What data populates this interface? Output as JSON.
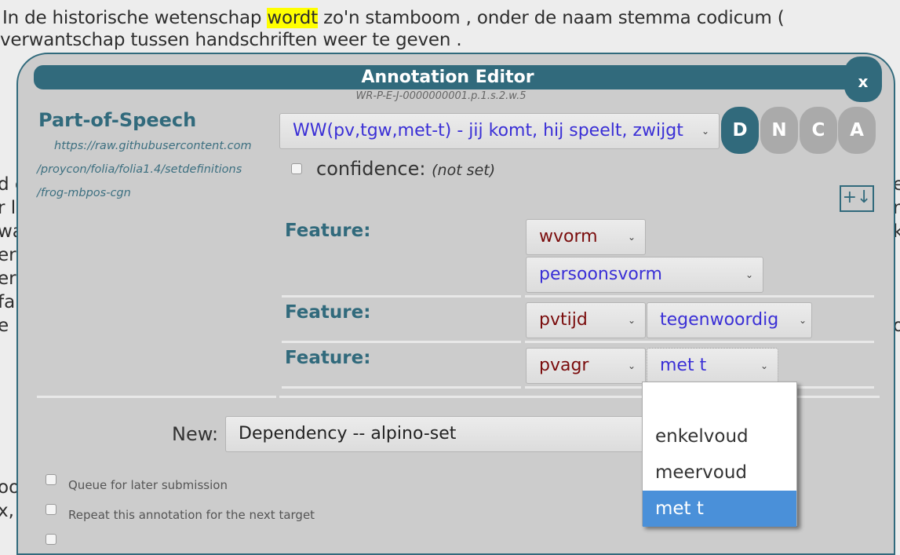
{
  "background": {
    "line1_before": "In de historische wetenschap ",
    "line1_highlight": "wordt",
    "line1_after": " zo'n stamboom , onder de naam stemma codicum (",
    "line2": " verwantschap tussen handschriften weer te geven .",
    "left_fragments": [
      "d e",
      "r l",
      "wa",
      "erg",
      "er",
      "fab",
      "e"
    ],
    "right_fragments": [
      "e",
      "r",
      "k",
      "o"
    ],
    "bottom_left_fragments": [
      "oo",
      "x,"
    ]
  },
  "dialog": {
    "title": "Annotation Editor",
    "close_label": "x",
    "target_id": "WR-P-E-J-0000000001.p.1.s.2.w.5",
    "annotation_type": "Part-of-Speech",
    "set_url_lines": [
      "https://raw.githubusercontent.com",
      "/proycon/folia/folia1.4/setdefinitions",
      "/frog-mbpos-cgn"
    ],
    "class_select": {
      "value": "WW(pv,tgw,met-t) - jij komt, hij speelt, zwijgt"
    },
    "mode_buttons": [
      {
        "label": "D",
        "active": true
      },
      {
        "label": "N",
        "active": false
      },
      {
        "label": "C",
        "active": false
      },
      {
        "label": "A",
        "active": false
      }
    ],
    "confidence": {
      "label": "confidence:",
      "value": "(not set)",
      "checked": false
    },
    "add_feature_label": "+↓",
    "features": [
      {
        "label": "Feature:",
        "subset": "wvorm",
        "value": "persoonsvorm"
      },
      {
        "label": "Feature:",
        "subset": "pvtijd",
        "value": "tegenwoordig"
      },
      {
        "label": "Feature:",
        "subset": "pvagr",
        "value": "met t"
      }
    ],
    "open_dropdown": {
      "options": [
        "",
        "enkelvoud",
        "meervoud",
        "met t"
      ],
      "selected": "met t"
    },
    "new_label": "New:",
    "new_select": {
      "value": "Dependency -- alpino-set"
    },
    "options": [
      {
        "label": "Queue for later submission",
        "checked": false
      },
      {
        "label": "Repeat this annotation for the next target",
        "checked": false
      }
    ]
  },
  "colors": {
    "accent": "#316a7c",
    "dialog_bg": "#cccccc",
    "highlight": "#ffff00",
    "class_text": "#3a2fd6",
    "subset_text": "#7a0c0c",
    "dropdown_selected": "#4a90d9"
  }
}
